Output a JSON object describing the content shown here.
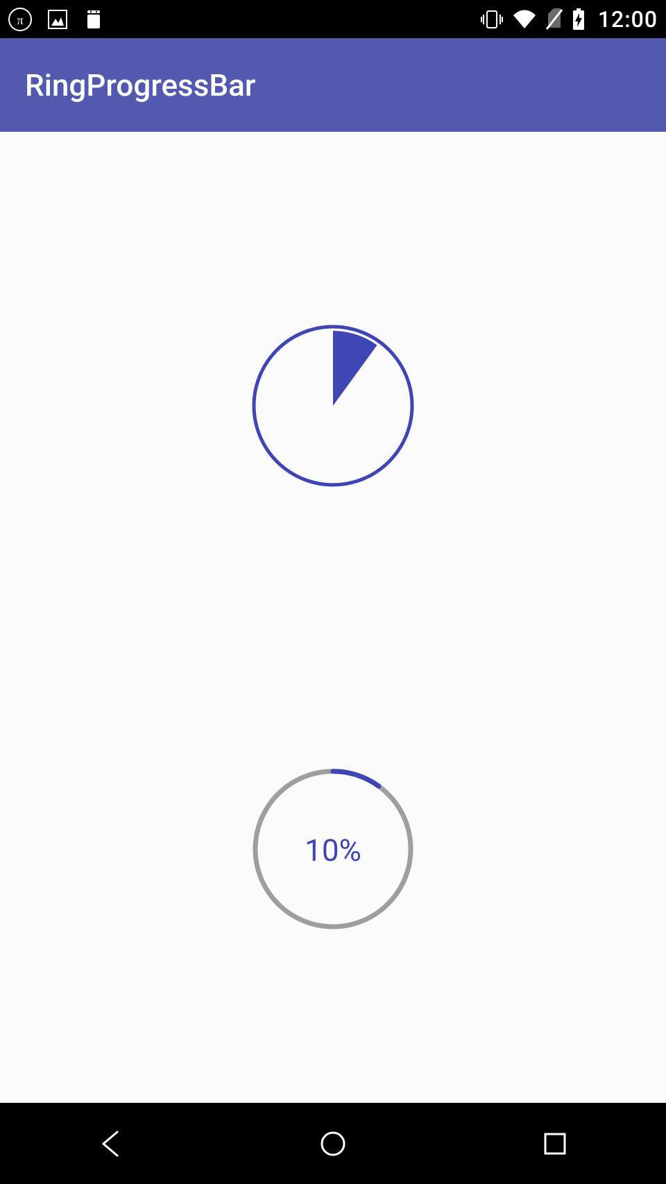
{
  "status_bar": {
    "time": "12:00"
  },
  "app_bar": {
    "title": "RingProgressBar"
  },
  "progress": {
    "pie_percent": 10,
    "ring_percent": 10,
    "ring_label": "10%"
  },
  "colors": {
    "primary": "#5459b0",
    "accent": "#3e45b5",
    "inactive": "#9e9e9e"
  }
}
